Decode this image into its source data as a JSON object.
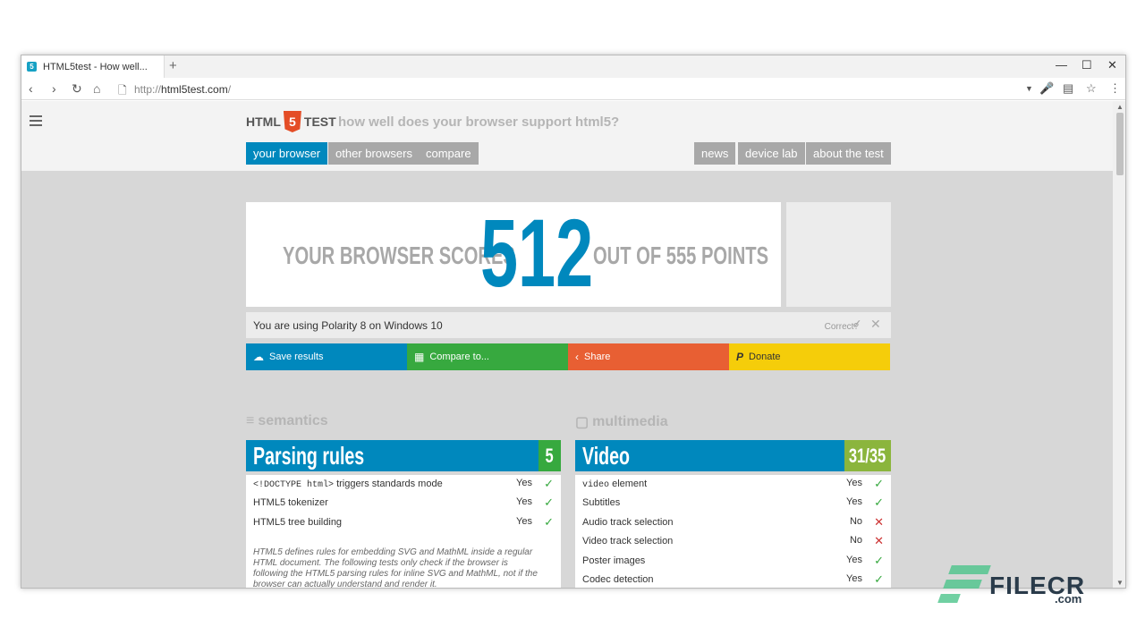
{
  "browser": {
    "tab_title": "HTML5test - How well...",
    "new_tab": "+",
    "url_scheme": "http://",
    "url_host": "html5test.com",
    "url_path": "/",
    "minimize": "—",
    "maximize": "☐",
    "close": "✕"
  },
  "site": {
    "logo_html": "HTML",
    "logo_five": "5",
    "logo_test": "TEST",
    "tagline": "how well does your browser support html5?",
    "nav_left": [
      "your browser",
      "other browsers",
      "compare"
    ],
    "nav_right": [
      "news",
      "device lab",
      "about the test"
    ],
    "active_nav": "your browser"
  },
  "score": {
    "pre": "YOUR BROWSER SCORES",
    "value": "512",
    "post": "OUT OF 555 POINTS"
  },
  "detected": {
    "text": "You are using Polarity 8 on Windows 10",
    "correct_label": "Correct?"
  },
  "actions": [
    {
      "label": "Save results",
      "color": "#0088bd",
      "icon": "cloud-upload-icon"
    },
    {
      "label": "Compare to...",
      "color": "#37a93f",
      "icon": "grid-icon"
    },
    {
      "label": "Share",
      "color": "#e85f33",
      "icon": "share-icon"
    },
    {
      "label": "Donate",
      "color": "#f5cd0a",
      "icon": "paypal-icon"
    }
  ],
  "sections": {
    "left": {
      "heading": "semantics",
      "category": "Parsing rules",
      "score": "5",
      "rows": [
        {
          "code": "<!DOCTYPE html>",
          "name": " triggers standards mode",
          "value": "Yes",
          "ok": true
        },
        {
          "code": "",
          "name": "HTML5 tokenizer",
          "value": "Yes",
          "ok": true
        },
        {
          "code": "",
          "name": "HTML5 tree building",
          "value": "Yes",
          "ok": true
        }
      ],
      "note": "HTML5 defines rules for embedding SVG and MathML inside a regular HTML document. The following tests only check if the browser is following the HTML5 parsing rules for inline SVG and MathML, not if the browser can actually understand and render it."
    },
    "right": {
      "heading": "multimedia",
      "category": "Video",
      "score": "31/35",
      "rows": [
        {
          "code": "video",
          "name": " element",
          "value": "Yes",
          "ok": true
        },
        {
          "code": "",
          "name": "Subtitles",
          "value": "Yes",
          "ok": true
        },
        {
          "code": "",
          "name": "Audio track selection",
          "value": "No",
          "ok": false
        },
        {
          "code": "",
          "name": "Video track selection",
          "value": "No",
          "ok": false
        },
        {
          "code": "",
          "name": "Poster images",
          "value": "Yes",
          "ok": true
        },
        {
          "code": "",
          "name": "Codec detection",
          "value": "Yes",
          "ok": true
        }
      ]
    }
  },
  "watermark": {
    "text": "FILECR",
    "suffix": ".com"
  }
}
